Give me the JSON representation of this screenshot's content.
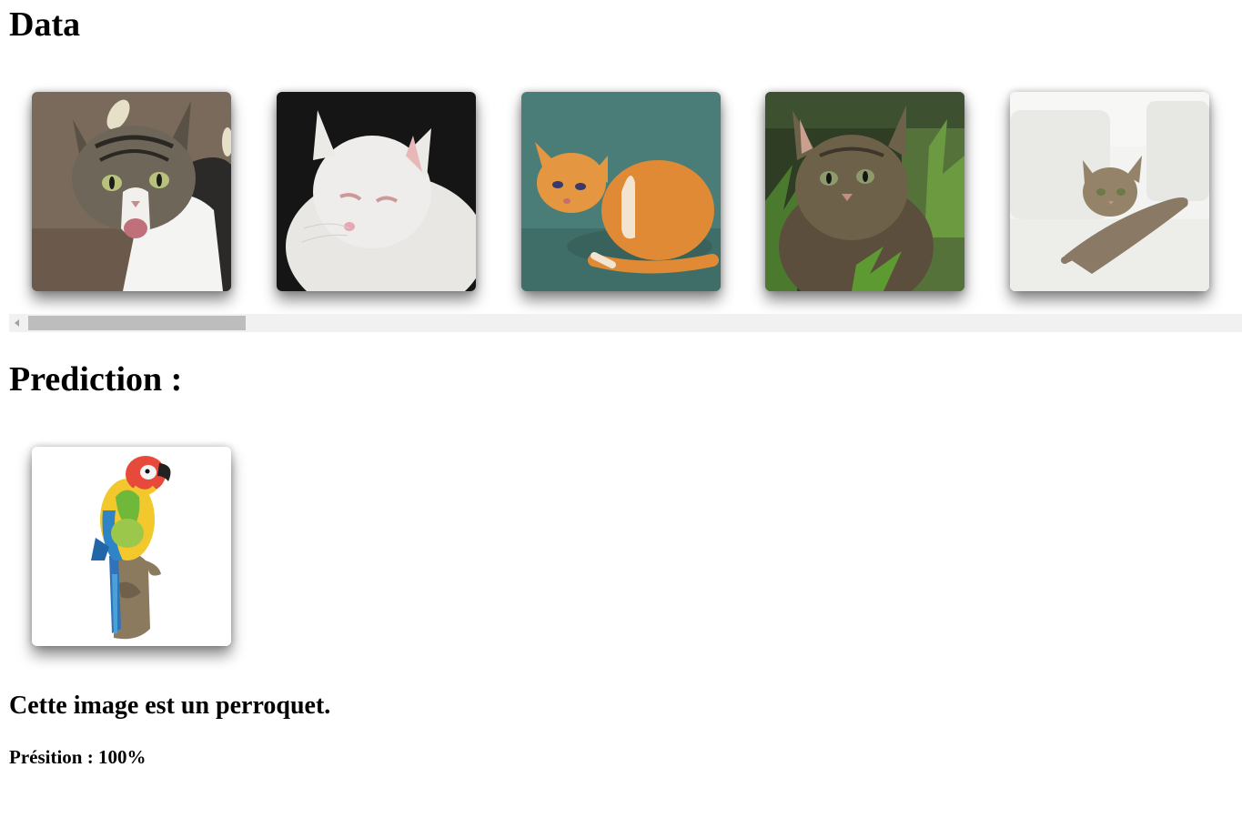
{
  "data_section": {
    "heading": "Data",
    "images": [
      {
        "subject": "tabby-white-cat-meowing"
      },
      {
        "subject": "white-kitten"
      },
      {
        "subject": "orange-kitten"
      },
      {
        "subject": "tabby-kitten-in-grass"
      },
      {
        "subject": "tabby-cat-on-white-sofa"
      }
    ],
    "scroll_position": 0
  },
  "prediction_section": {
    "heading": "Prediction :",
    "image_subject": "parrot-figurine",
    "result": "Cette image est un perroquet.",
    "precision": "Présition : 100%"
  }
}
